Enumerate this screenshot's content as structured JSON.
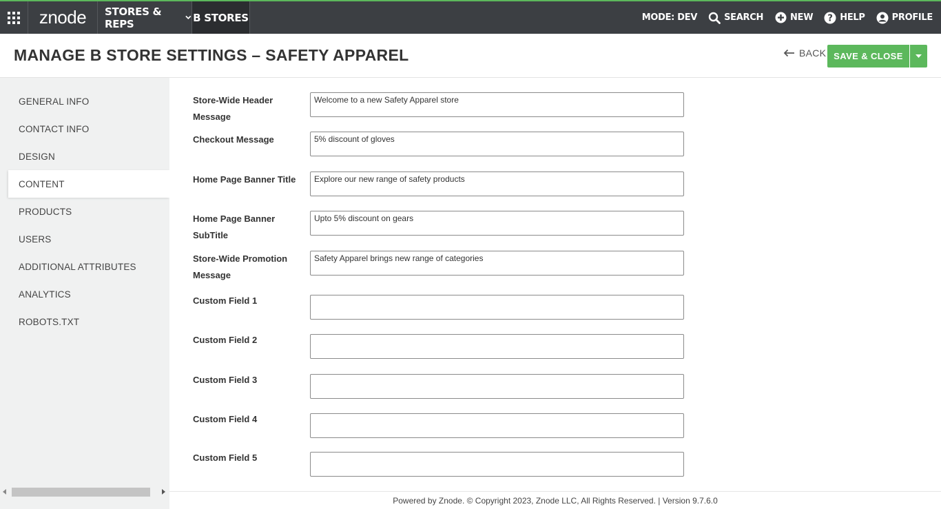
{
  "navbar": {
    "logo": "znode",
    "stores_menu": "STORES & REPS",
    "bstores": "B STORES",
    "mode": "MODE: DEV",
    "search": "SEARCH",
    "new": "NEW",
    "help": "HELP",
    "profile": "PROFILE"
  },
  "header": {
    "title": "MANAGE B STORE SETTINGS – SAFETY APPAREL",
    "back": "BACK",
    "save": "SAVE & CLOSE"
  },
  "sidebar": {
    "items": [
      {
        "label": "GENERAL INFO"
      },
      {
        "label": "CONTACT INFO"
      },
      {
        "label": "DESIGN"
      },
      {
        "label": "CONTENT"
      },
      {
        "label": "PRODUCTS"
      },
      {
        "label": "USERS"
      },
      {
        "label": "ADDITIONAL ATTRIBUTES"
      },
      {
        "label": "ANALYTICS"
      },
      {
        "label": "ROBOTS.TXT"
      }
    ],
    "active_index": 3
  },
  "form": {
    "fields": [
      {
        "label": "Store-Wide Header Message",
        "value": "Welcome to a new Safety Apparel store"
      },
      {
        "label": "Checkout Message",
        "value": "5% discount of gloves"
      },
      {
        "label": "Home Page Banner Title",
        "value": "Explore our new range of safety products"
      },
      {
        "label": "Home Page Banner SubTitle",
        "value": "Upto 5% discount on gears"
      },
      {
        "label": "Store-Wide Promotion Message",
        "value": "Safety Apparel brings new range of categories"
      },
      {
        "label": "Custom Field 1",
        "value": ""
      },
      {
        "label": "Custom Field 2",
        "value": ""
      },
      {
        "label": "Custom Field 3",
        "value": ""
      },
      {
        "label": "Custom Field 4",
        "value": ""
      },
      {
        "label": "Custom Field 5",
        "value": ""
      }
    ]
  },
  "footer": {
    "text": "Powered by Znode. © Copyright 2023, Znode LLC, All Rights Reserved. | Version 9.7.6.0"
  },
  "colors": {
    "navbar_bg": "#3c3f43",
    "accent": "#5cb85c",
    "sidebar_bg": "#f0f1f1"
  }
}
